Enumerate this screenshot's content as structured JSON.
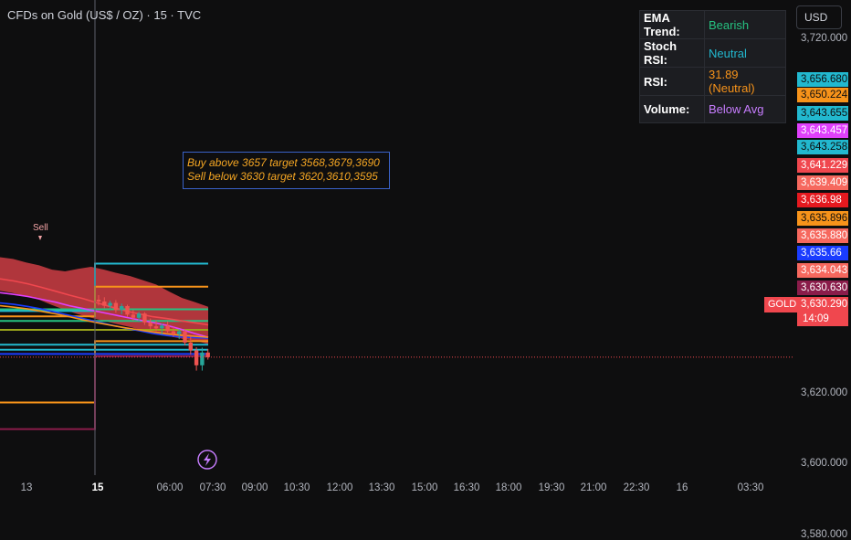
{
  "header": {
    "title": "CFDs on Gold (US$ / OZ) · 15 · TVC",
    "currency_button": "USD"
  },
  "indicator_table": [
    {
      "key": "EMA Trend:",
      "value": "Bearish",
      "color": "#26c281"
    },
    {
      "key": "Stoch RSI:",
      "value": "Neutral",
      "color": "#22b8cf"
    },
    {
      "key": "RSI:",
      "value": "31.89 (Neutral)",
      "color": "#f7931a"
    },
    {
      "key": "Volume:",
      "value": "Below Avg",
      "color": "#c77dff"
    }
  ],
  "annotation": {
    "line1": "Buy above 3657 target 3568,3679,3690",
    "line2": "Sell below 3630 target 3620,3610,3595",
    "text_color": "#f5a623",
    "border_color": "#3a62c8"
  },
  "sell_label": "Sell",
  "symbol_label": "GOLD",
  "last_price": {
    "value": "3,630.290",
    "countdown": "14:09"
  },
  "price_tags": [
    {
      "value": "3,656.680",
      "bg": "#22b8cf",
      "fg": "#0e0e0f"
    },
    {
      "value": "3,650.224",
      "bg": "#f7931a",
      "fg": "#0e0e0f"
    },
    {
      "value": "3,643.655",
      "bg": "#22b8cf",
      "fg": "#0e0e0f"
    },
    {
      "value": "3,643.457",
      "bg": "#e040fb",
      "fg": "#ffffff"
    },
    {
      "value": "3,643.258",
      "bg": "#22b8cf",
      "fg": "#0e0e0f"
    },
    {
      "value": "3,641.229",
      "bg": "#f0474e",
      "fg": "#ffffff"
    },
    {
      "value": "3,639.409",
      "bg": "#f6685e",
      "fg": "#ffffff"
    },
    {
      "value": "3,636.98",
      "bg": "#e5191f",
      "fg": "#ffffff"
    },
    {
      "value": "3,635.896",
      "bg": "#f7931a",
      "fg": "#0e0e0f"
    },
    {
      "value": "3,635.880",
      "bg": "#f6685e",
      "fg": "#ffffff"
    },
    {
      "value": "3,635.66",
      "bg": "#1a3cff",
      "fg": "#ffffff"
    },
    {
      "value": "3,634.043",
      "bg": "#f6685e",
      "fg": "#ffffff"
    },
    {
      "value": "3,630.630",
      "bg": "#8a1c4a",
      "fg": "#ffffff"
    }
  ],
  "chart_data": {
    "type": "line",
    "title": "CFDs on Gold (US$ / OZ) · 15 · TVC",
    "y_axis": {
      "ticks": [
        "3,720.000",
        "3,620.000",
        "3,600.000",
        "3,580.000"
      ],
      "tick_values": [
        3720,
        3620,
        3600,
        3580
      ],
      "ylim": [
        3570,
        3730
      ]
    },
    "x_axis": {
      "ticks": [
        "13",
        "15",
        "06:00",
        "07:30",
        "09:00",
        "10:30",
        "12:00",
        "13:30",
        "15:00",
        "16:30",
        "18:00",
        "19:30",
        "21:00",
        "22:30",
        "16",
        "03:30"
      ],
      "bold_ticks": [
        "15"
      ]
    },
    "candles": [
      {
        "o": 3646.5,
        "h": 3647.8,
        "l": 3644.9,
        "c": 3646.0
      },
      {
        "o": 3646.0,
        "h": 3647.2,
        "l": 3644.1,
        "c": 3644.8
      },
      {
        "o": 3644.8,
        "h": 3646.2,
        "l": 3643.5,
        "c": 3645.6
      },
      {
        "o": 3645.6,
        "h": 3646.4,
        "l": 3642.8,
        "c": 3643.6
      },
      {
        "o": 3643.6,
        "h": 3645.4,
        "l": 3642.4,
        "c": 3644.7
      },
      {
        "o": 3644.7,
        "h": 3645.1,
        "l": 3641.6,
        "c": 3642.3
      },
      {
        "o": 3642.3,
        "h": 3643.6,
        "l": 3640.6,
        "c": 3641.4
      },
      {
        "o": 3641.4,
        "h": 3643.1,
        "l": 3640.2,
        "c": 3642.6
      },
      {
        "o": 3642.6,
        "h": 3643.0,
        "l": 3639.4,
        "c": 3640.1
      },
      {
        "o": 3640.1,
        "h": 3641.2,
        "l": 3638.1,
        "c": 3639.0
      },
      {
        "o": 3639.0,
        "h": 3640.6,
        "l": 3637.6,
        "c": 3638.4
      },
      {
        "o": 3638.4,
        "h": 3639.8,
        "l": 3636.6,
        "c": 3639.2
      },
      {
        "o": 3639.2,
        "h": 3640.4,
        "l": 3637.2,
        "c": 3637.6
      },
      {
        "o": 3637.6,
        "h": 3638.8,
        "l": 3636.1,
        "c": 3636.8
      },
      {
        "o": 3636.8,
        "h": 3638.2,
        "l": 3635.4,
        "c": 3637.6
      },
      {
        "o": 3637.6,
        "h": 3638.0,
        "l": 3633.6,
        "c": 3634.4
      },
      {
        "o": 3634.4,
        "h": 3636.2,
        "l": 3631.0,
        "c": 3632.2
      },
      {
        "o": 3632.2,
        "h": 3633.1,
        "l": 3626.5,
        "c": 3628.0
      },
      {
        "o": 3628.0,
        "h": 3633.0,
        "l": 3626.5,
        "c": 3631.6
      },
      {
        "o": 3631.6,
        "h": 3632.6,
        "l": 3629.6,
        "c": 3630.3
      }
    ],
    "levels": [
      {
        "color": "#22b8cf",
        "before": 3643.3,
        "after": 3656.7
      },
      {
        "color": "#f7931a",
        "before": 3641.8,
        "after": 3650.2
      },
      {
        "color": "#f7931a",
        "before": 3617.5,
        "after": 3634.8
      },
      {
        "color": "#8a1c4a",
        "before": 3610.0,
        "after": 3630.6
      },
      {
        "color": "#22b8cf",
        "before": 3633.8,
        "after": 3633.8
      },
      {
        "color": "#22b8cf",
        "before": 3632.4,
        "after": 3632.4
      },
      {
        "color": "#1a3cff",
        "before": 3631.2,
        "after": 3631.2
      },
      {
        "color": "#26c281",
        "before": 3643.8,
        "after": 3643.8
      },
      {
        "color": "#26c281",
        "before": 3640.5,
        "after": 3640.5
      },
      {
        "color": "#9aa41a",
        "before": 3638.0,
        "after": 3638.0
      }
    ],
    "ema_lines": [
      {
        "color": "#f0474e",
        "values": [
          3652.4,
          3651.8,
          3651.0,
          3650.0,
          3648.9,
          3647.8,
          3646.8,
          3645.6,
          3644.5,
          3643.4,
          3642.5,
          3641.7,
          3641.2,
          3640.6,
          3640.0,
          3639.4
        ]
      },
      {
        "color": "#e040fb",
        "values": [
          3648.5,
          3648.0,
          3647.4,
          3646.6,
          3645.8,
          3644.8,
          3644.0,
          3643.2,
          3642.4,
          3641.6,
          3640.8,
          3640.1,
          3639.3,
          3638.2,
          3637.0,
          3635.9
        ]
      },
      {
        "color": "#1a3cff",
        "values": [
          3645.6,
          3645.2,
          3644.6,
          3643.9,
          3643.0,
          3642.1,
          3641.2,
          3640.3,
          3639.4,
          3638.5,
          3637.8,
          3637.0,
          3636.4,
          3636.0,
          3635.8,
          3635.7
        ]
      },
      {
        "color": "#f7931a",
        "values": [
          3644.8,
          3644.4,
          3643.9,
          3643.2,
          3642.5,
          3641.7,
          3640.8,
          3640.0,
          3639.3,
          3638.6,
          3638.0,
          3637.4,
          3636.9,
          3636.5,
          3636.2,
          3635.9
        ]
      }
    ],
    "cloud": {
      "color": "#f0474e",
      "upper": [
        3658.5,
        3658.0,
        3657.0,
        3656.2,
        3655.0,
        3654.5,
        3655.2,
        3655.8,
        3655.0,
        3654.0,
        3653.2,
        3652.0,
        3650.8,
        3648.8,
        3647.0,
        3645.8,
        3644.5
      ],
      "lower": [
        3649.0,
        3648.4,
        3647.5,
        3646.5,
        3645.0,
        3643.6,
        3642.4,
        3641.4,
        3640.5,
        3639.6,
        3638.8,
        3637.8,
        3637.0,
        3636.2,
        3635.5,
        3634.9,
        3634.0
      ]
    },
    "last_price": 3630.29
  }
}
